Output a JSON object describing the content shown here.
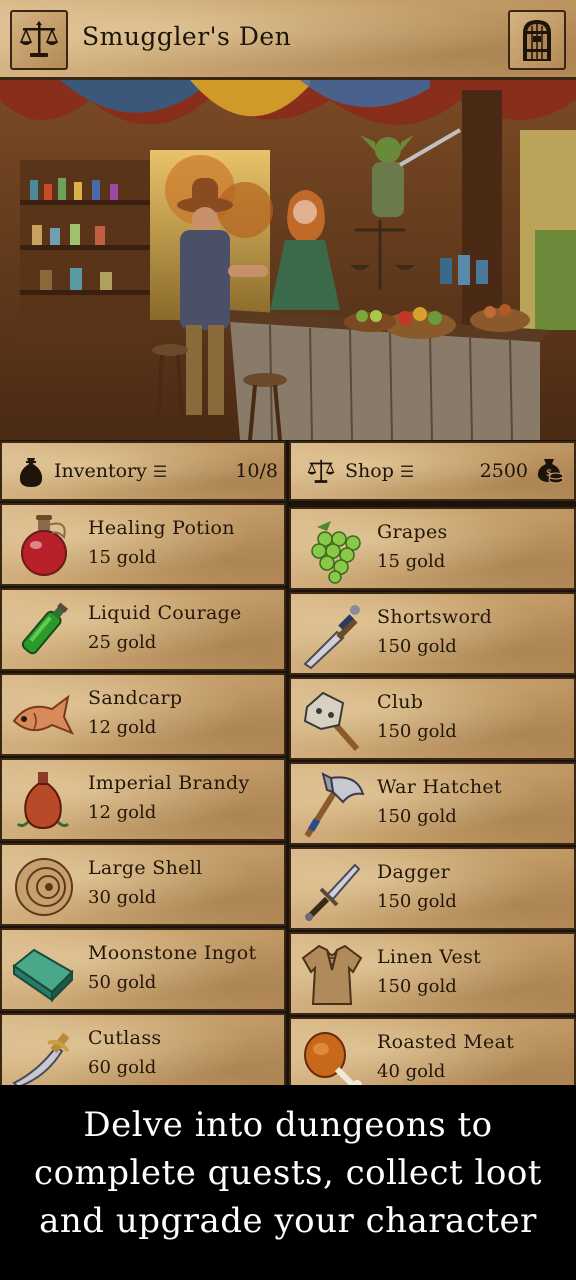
{
  "header": {
    "title": "Smuggler's Den"
  },
  "inventory": {
    "label": "Inventory",
    "count": "10/8"
  },
  "shop": {
    "label": "Shop",
    "gold": "2500"
  },
  "inventory_items": [
    {
      "name": "Healing Potion",
      "price": "15 gold",
      "icon": "potion-red-icon"
    },
    {
      "name": "Liquid Courage",
      "price": "25 gold",
      "icon": "bottle-green-icon"
    },
    {
      "name": "Sandcarp",
      "price": "12 gold",
      "icon": "fish-icon"
    },
    {
      "name": "Imperial Brandy",
      "price": "12 gold",
      "icon": "brandy-jug-icon"
    },
    {
      "name": "Large Shell",
      "price": "30 gold",
      "icon": "shell-icon"
    },
    {
      "name": "Moonstone Ingot",
      "price": "50 gold",
      "icon": "ingot-icon"
    },
    {
      "name": "Cutlass",
      "price": "60 gold",
      "icon": "cutlass-icon"
    }
  ],
  "shop_items": [
    {
      "name": "Grapes",
      "price": "15 gold",
      "icon": "grapes-icon"
    },
    {
      "name": "Shortsword",
      "price": "150 gold",
      "icon": "shortsword-icon"
    },
    {
      "name": "Club",
      "price": "150 gold",
      "icon": "club-icon"
    },
    {
      "name": "War Hatchet",
      "price": "150 gold",
      "icon": "hatchet-icon"
    },
    {
      "name": "Dagger",
      "price": "150 gold",
      "icon": "dagger-icon"
    },
    {
      "name": "Linen Vest",
      "price": "150 gold",
      "icon": "vest-icon"
    },
    {
      "name": "Roasted Meat",
      "price": "40 gold",
      "icon": "meat-icon"
    }
  ],
  "footer": {
    "line1": "Delve into dungeons to",
    "line2": "complete quests, collect loot",
    "line3": "and upgrade your character"
  }
}
